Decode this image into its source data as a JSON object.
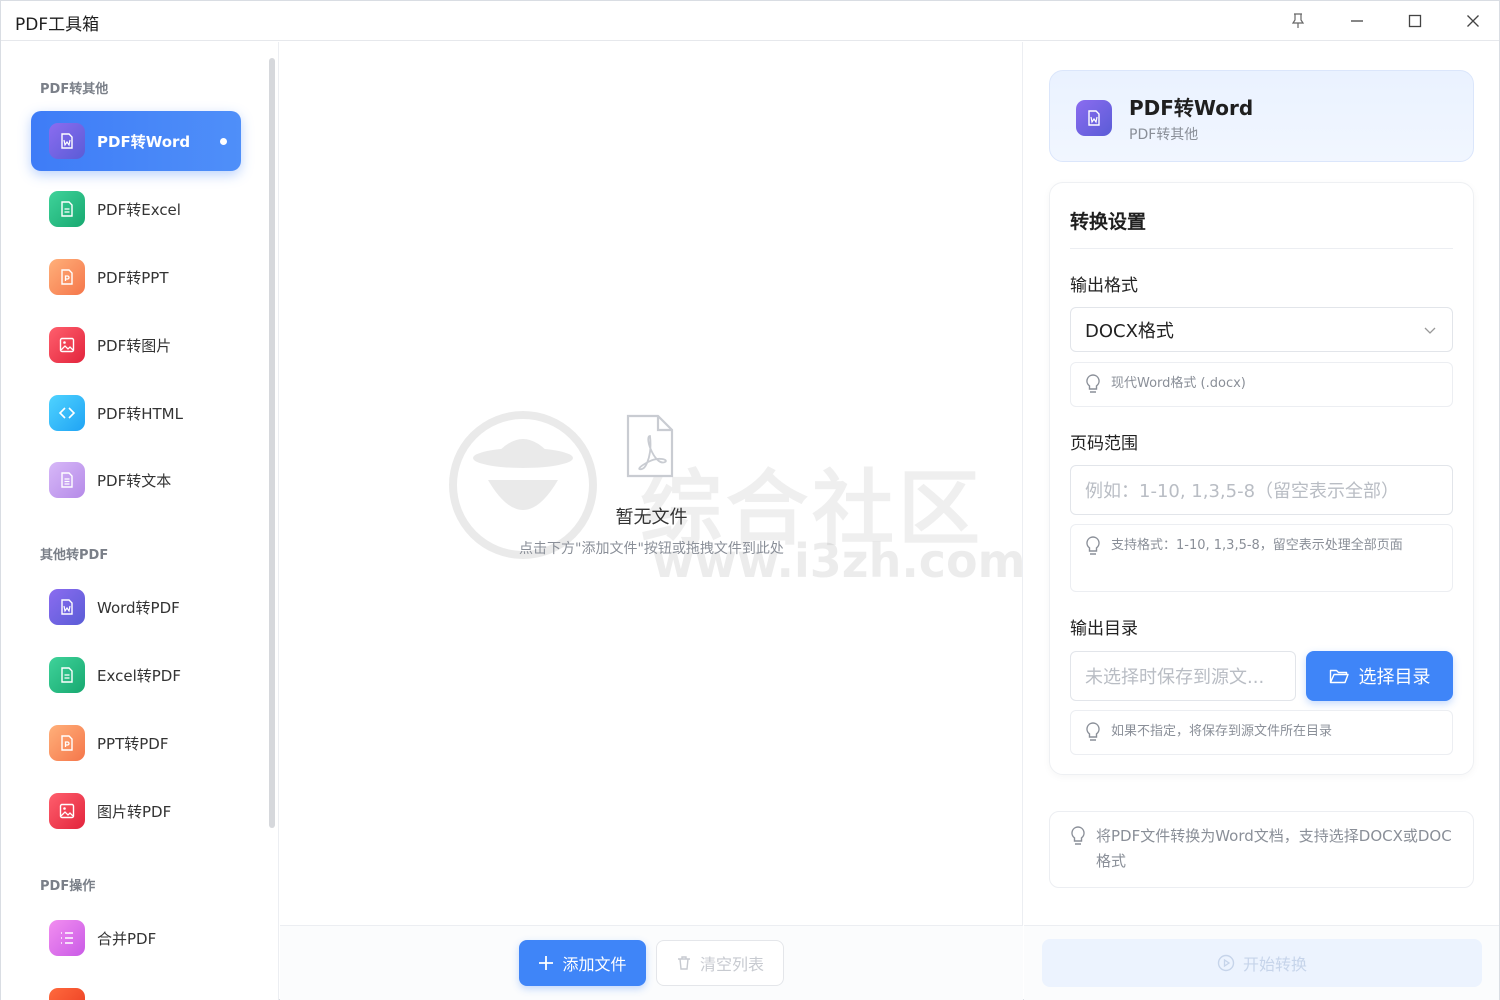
{
  "app": {
    "title": "PDF工具箱"
  },
  "sidebar": {
    "sections": [
      {
        "label": "PDF转其他"
      },
      {
        "label": "其他转PDF"
      },
      {
        "label": "PDF操作"
      }
    ],
    "items": [
      {
        "label": "PDF转Word",
        "icon": "word-doc-icon"
      },
      {
        "label": "PDF转Excel",
        "icon": "excel-doc-icon"
      },
      {
        "label": "PDF转PPT",
        "icon": "ppt-doc-icon"
      },
      {
        "label": "PDF转图片",
        "icon": "image-icon"
      },
      {
        "label": "PDF转HTML",
        "icon": "code-icon"
      },
      {
        "label": "PDF转文本",
        "icon": "text-doc-icon"
      },
      {
        "label": "Word转PDF",
        "icon": "word-doc-icon"
      },
      {
        "label": "Excel转PDF",
        "icon": "excel-doc-icon"
      },
      {
        "label": "PPT转PDF",
        "icon": "ppt-doc-icon"
      },
      {
        "label": "图片转PDF",
        "icon": "image-icon"
      },
      {
        "label": "合并PDF",
        "icon": "list-merge-icon"
      }
    ],
    "active_index": 0
  },
  "main": {
    "empty_title": "暂无文件",
    "empty_hint": "点击下方\"添加文件\"按钮或拖拽文件到此处",
    "watermark_line1": "综合社区",
    "watermark_line2": "www.i3zh.com",
    "add_button": "添加文件",
    "clear_button": "清空列表"
  },
  "panel": {
    "title": "PDF转Word",
    "subtitle": "PDF转其他",
    "settings_title": "转换设置",
    "output_format_label": "输出格式",
    "output_format_value": "DOCX格式",
    "output_format_tip": "现代Word格式 (.docx)",
    "page_range_label": "页码范围",
    "page_range_placeholder": "例如：1-10, 1,3,5-8（留空表示全部）",
    "page_range_tip": "支持格式：1-10, 1,3,5-8，留空表示处理全部页面",
    "output_dir_label": "输出目录",
    "output_dir_placeholder": "未选择时保存到源文...",
    "choose_dir_button": "选择目录",
    "output_dir_tip": "如果不指定，将保存到源文件所在目录",
    "description": "将PDF文件转换为Word文档，支持选择DOCX或DOC格式",
    "start_button": "开始转换"
  },
  "colors": {
    "accent": "#3f85f8",
    "active_nav": "#4080f7"
  }
}
